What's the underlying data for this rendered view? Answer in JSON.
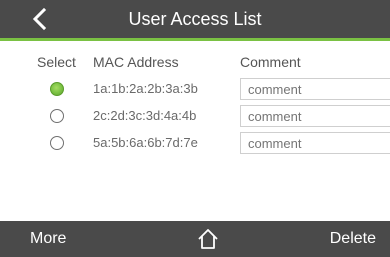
{
  "header": {
    "title": "User Access List",
    "back_icon": "chevron-left-icon"
  },
  "columns": {
    "select": "Select",
    "mac": "MAC Address",
    "comment": "Comment"
  },
  "rows": [
    {
      "mac": "1a:1b:2a:2b:3a:3b",
      "comment_placeholder": "comment",
      "selected": true
    },
    {
      "mac": "2c:2d:3c:3d:4a:4b",
      "comment_placeholder": "comment",
      "selected": false
    },
    {
      "mac": "5a:5b:6a:6b:7d:7e",
      "comment_placeholder": "comment",
      "selected": false
    }
  ],
  "footer": {
    "more_label": "More",
    "home_icon": "home-icon",
    "delete_label": "Delete"
  },
  "colors": {
    "bar_background": "#4a4a4a",
    "accent_green": "#7ac143"
  }
}
